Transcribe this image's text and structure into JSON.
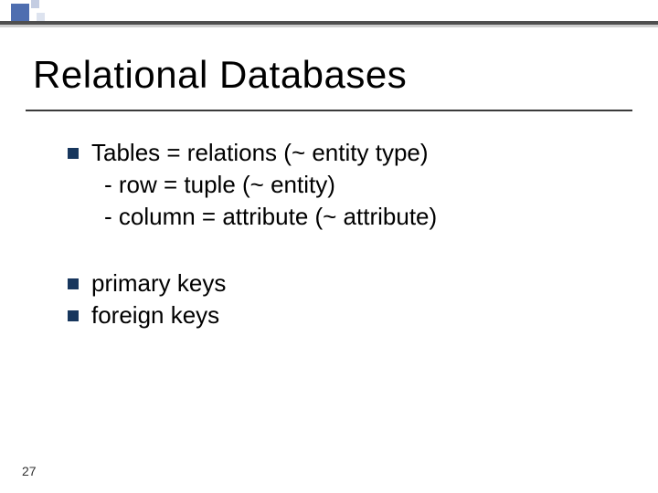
{
  "slide": {
    "title": "Relational Databases",
    "bullets": {
      "b1": {
        "line1": "Tables = relations (~ entity type)",
        "sub1": "- row = tuple (~ entity)",
        "sub2": "- column = attribute (~ attribute)"
      },
      "b2": "primary keys",
      "b3": "foreign keys"
    },
    "page_number": "27"
  }
}
